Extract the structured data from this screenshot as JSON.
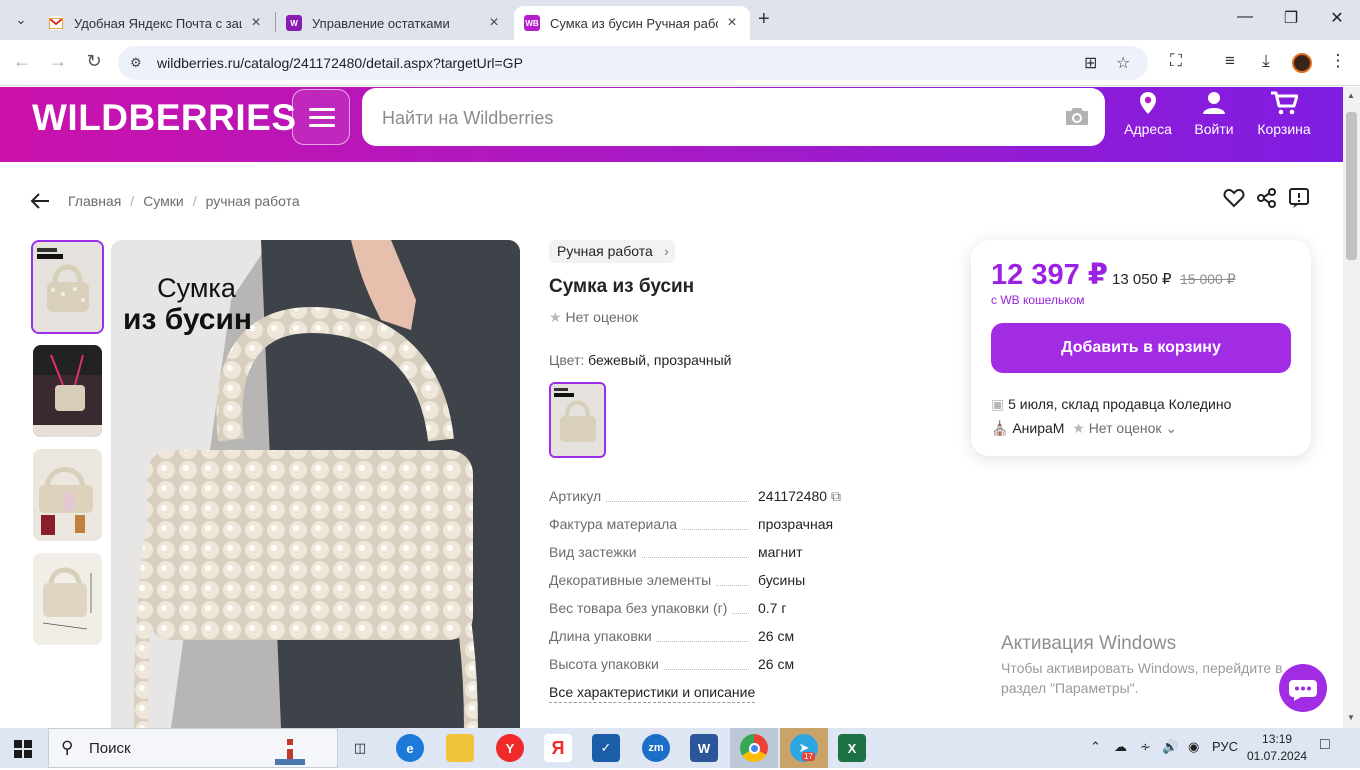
{
  "browser": {
    "tabs": [
      {
        "label": "Удобная Яндекс Почта с защи",
        "favicon": "gmail-icon"
      },
      {
        "label": "Управление остатками",
        "favicon": "wb-icon"
      },
      {
        "label": "Сумка из бусин Ручная работа",
        "favicon": "wb-icon",
        "active": true
      }
    ],
    "url": "wildberries.ru/catalog/241172480/detail.aspx?targetUrl=GP",
    "wb_fav": "WB"
  },
  "header": {
    "logo": "WILDBERRIES",
    "search_placeholder": "Найти на Wildberries",
    "nav": [
      {
        "label": "Адреса",
        "icon": "location-pin-icon"
      },
      {
        "label": "Войти",
        "icon": "user-icon"
      },
      {
        "label": "Корзина",
        "icon": "cart-icon"
      }
    ]
  },
  "breadcrumbs": [
    "Главная",
    "Сумки",
    "ручная работа"
  ],
  "gallery": {
    "main_caption_line1": "Сумка",
    "main_caption_line2": "из бусин"
  },
  "product": {
    "brand": "Ручная работа",
    "title": "Сумка из бусин",
    "rating_text": "Нет оценок",
    "color_label": "Цвет:",
    "color_value": "бежевый, прозрачный",
    "specs": [
      {
        "key": "Артикул",
        "value": "241172480"
      },
      {
        "key": "Фактура материала",
        "value": "прозрачная"
      },
      {
        "key": "Вид застежки",
        "value": "магнит"
      },
      {
        "key": "Декоративные элементы",
        "value": "бусины"
      },
      {
        "key": "Вес товара без упаковки (г)",
        "value": "0.7 г"
      },
      {
        "key": "Длина упаковки",
        "value": "26 см"
      },
      {
        "key": "Высота упаковки",
        "value": "26 см"
      }
    ],
    "all_specs_link": "Все характеристики и описание"
  },
  "price_card": {
    "price": "12 397 ₽",
    "price_regular": "13 050 ₽",
    "price_old": "15 000 ₽",
    "wallet_note": "с WB кошельком",
    "add_to_cart": "Добавить в корзину",
    "delivery_date": "5 июля",
    "delivery_rest": ", склад продавца Коледино",
    "seller": "АнираМ",
    "seller_rating": "Нет оценок"
  },
  "activation": {
    "title": "Активация Windows",
    "text": "Чтобы активировать Windows, перейдите в раздел \"Параметры\"."
  },
  "taskbar": {
    "search": "Поиск",
    "lang": "РУС",
    "time": "13:19",
    "date": "01.07.2024",
    "telegram_badge": "17"
  },
  "colors": {
    "accent": "#a22be4",
    "header_start": "#cb11ab",
    "header_end": "#7f1de2"
  }
}
